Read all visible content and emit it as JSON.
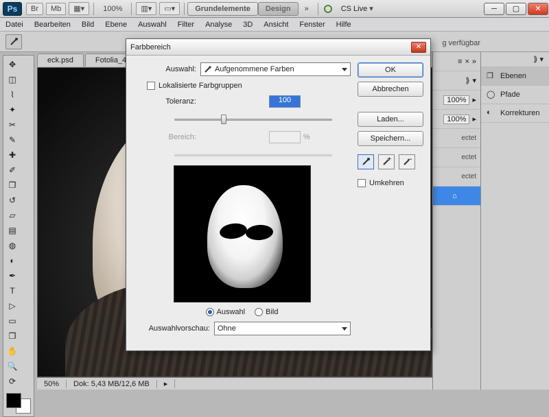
{
  "titlebar": {
    "ps": "Ps",
    "zoom": "100%",
    "ws_primary": "Grundelemente",
    "ws_secondary": "Design",
    "more": "»",
    "cslive": "CS Live"
  },
  "menu": [
    "Datei",
    "Bearbeiten",
    "Bild",
    "Ebene",
    "Auswahl",
    "Filter",
    "Analyse",
    "3D",
    "Ansicht",
    "Fenster",
    "Hilfe"
  ],
  "availability_hint": "g verfügbar",
  "doc_tabs": [
    "eck.psd",
    "Fotolia_4"
  ],
  "statusbar": {
    "zoom": "50%",
    "doc": "Dok: 5,43 MB/12,6 MB"
  },
  "right_panels": {
    "items": [
      "Ebenen",
      "Pfade",
      "Korrekturen"
    ],
    "opacity_pct": "100%",
    "row_suffix": "ectet"
  },
  "dialog": {
    "title": "Farbbereich",
    "auswahl_label": "Auswahl:",
    "auswahl_value": "Aufgenommene Farben",
    "localized_label": "Lokalisierte Farbgruppen",
    "toleranz_label": "Toleranz:",
    "toleranz_value": "100",
    "bereich_label": "Bereich:",
    "bereich_unit": "%",
    "radio_auswahl": "Auswahl",
    "radio_bild": "Bild",
    "vorschau_label": "Auswahlvorschau:",
    "vorschau_value": "Ohne",
    "ok": "OK",
    "cancel": "Abbrechen",
    "load": "Laden...",
    "save": "Speichern...",
    "invert": "Umkehren"
  }
}
